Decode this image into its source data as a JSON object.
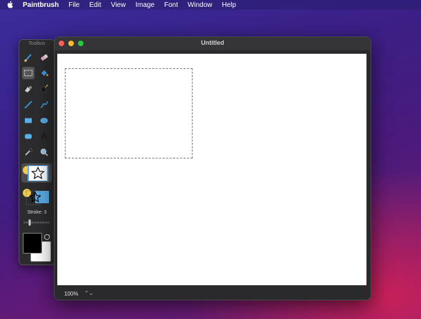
{
  "menubar": {
    "app_name": "Paintbrush",
    "items": [
      "File",
      "Edit",
      "View",
      "Image",
      "Font",
      "Window",
      "Help"
    ]
  },
  "toolbox": {
    "title": "Toolbox",
    "stroke_label": "Stroke: 3",
    "foreground_color": "#000000",
    "background_color": "#ffffff"
  },
  "window": {
    "title": "Untitled",
    "zoom": "100%",
    "zoom_stepper": "⌃⌄"
  },
  "colors": {
    "close": "#fe5f57",
    "minimize": "#febc2e",
    "zoom": "#28c840"
  }
}
